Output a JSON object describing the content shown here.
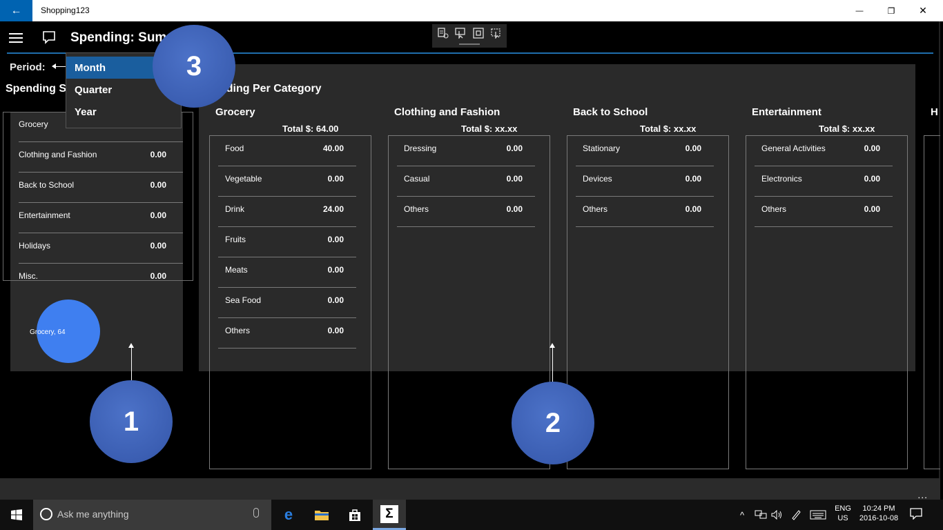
{
  "window": {
    "title": "Shopping123",
    "back_glyph": "←",
    "minimize_glyph": "—",
    "restore_glyph": "❐",
    "close_glyph": "✕"
  },
  "header": {
    "page_title": "Spending: Sum"
  },
  "period": {
    "label": "Period:",
    "options": [
      "Month",
      "Quarter",
      "Year"
    ],
    "selected": "Month"
  },
  "summary": {
    "title": "Spending Su",
    "rows": [
      {
        "name": "Grocery",
        "value": ""
      },
      {
        "name": "Clothing and Fashion",
        "value": "0.00"
      },
      {
        "name": "Back to School",
        "value": "0.00"
      },
      {
        "name": "Entertainment",
        "value": "0.00"
      },
      {
        "name": "Holidays",
        "value": "0.00"
      },
      {
        "name": "Misc.",
        "value": "0.00"
      }
    ],
    "pie_label": "Grocery, 64"
  },
  "category": {
    "title": "nding Per Category",
    "columns": [
      {
        "name": "Grocery",
        "total": "Total $: 64.00",
        "rows": [
          {
            "name": "Food",
            "value": "40.00"
          },
          {
            "name": "Vegetable",
            "value": "0.00"
          },
          {
            "name": "Drink",
            "value": "24.00"
          },
          {
            "name": "Fruits",
            "value": "0.00"
          },
          {
            "name": "Meats",
            "value": "0.00"
          },
          {
            "name": "Sea Food",
            "value": "0.00"
          },
          {
            "name": "Others",
            "value": "0.00"
          }
        ]
      },
      {
        "name": "Clothing and Fashion",
        "total": "Total $: xx.xx",
        "rows": [
          {
            "name": "Dressing",
            "value": "0.00"
          },
          {
            "name": "Casual",
            "value": "0.00"
          },
          {
            "name": "Others",
            "value": "0.00"
          }
        ]
      },
      {
        "name": "Back to School",
        "total": "Total $: xx.xx",
        "rows": [
          {
            "name": "Stationary",
            "value": "0.00"
          },
          {
            "name": "Devices",
            "value": "0.00"
          },
          {
            "name": "Others",
            "value": "0.00"
          }
        ]
      },
      {
        "name": "Entertainment",
        "total": "Total $: xx.xx",
        "rows": [
          {
            "name": "General Activities",
            "value": "0.00"
          },
          {
            "name": "Electronics",
            "value": "0.00"
          },
          {
            "name": "Others",
            "value": "0.00"
          }
        ]
      }
    ],
    "cut_column_initial": "H"
  },
  "callouts": [
    "1",
    "2",
    "3"
  ],
  "app_bar": {
    "more_glyph": "..."
  },
  "taskbar": {
    "search_placeholder": "Ask me anything",
    "lang_line1": "ENG",
    "lang_line2": "US",
    "time": "10:24 PM",
    "date": "2016-10-08",
    "sigma_glyph": "Σ",
    "edge_glyph": "e"
  },
  "colors": {
    "accent": "#0063b1",
    "header_line": "#1f6fad",
    "pie": "#3f7ff0",
    "callout": "#3b5eb2",
    "selected_option": "#1a5e9e"
  }
}
